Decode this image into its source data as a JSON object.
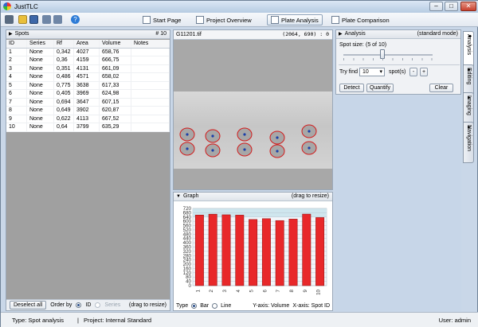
{
  "app": {
    "title": "JustTLC"
  },
  "window_buttons": {
    "minimize": "–",
    "maximize": "□",
    "close": "✕"
  },
  "toolbar": {
    "icons": [
      "menu-icon",
      "open-folder-icon",
      "save-icon",
      "undo-icon",
      "redo-icon",
      "help-icon"
    ],
    "nav": [
      {
        "label": "Start Page",
        "icon": "home-icon"
      },
      {
        "label": "Project Overview",
        "icon": "overview-icon"
      },
      {
        "label": "Plate Analysis",
        "icon": "plate-icon",
        "active": true
      },
      {
        "label": "Plate Comparison",
        "icon": "compare-icon"
      }
    ]
  },
  "spots": {
    "title": "Spots",
    "count": "# 10",
    "columns": [
      "ID",
      "Series",
      "Rf",
      "Area",
      "Volume",
      "Notes"
    ],
    "rows": [
      [
        "1",
        "None",
        "0,342",
        "4027",
        "658,76",
        ""
      ],
      [
        "2",
        "None",
        "0,36",
        "4159",
        "666,75",
        ""
      ],
      [
        "3",
        "None",
        "0,351",
        "4131",
        "661,09",
        ""
      ],
      [
        "4",
        "None",
        "0,486",
        "4571",
        "658,02",
        ""
      ],
      [
        "5",
        "None",
        "0,775",
        "3638",
        "617,33",
        ""
      ],
      [
        "6",
        "None",
        "0,405",
        "3969",
        "624,98",
        ""
      ],
      [
        "7",
        "None",
        "0,694",
        "3647",
        "607,15",
        ""
      ],
      [
        "8",
        "None",
        "0,649",
        "3902",
        "620,87",
        ""
      ],
      [
        "9",
        "None",
        "0,622",
        "4113",
        "667,52",
        ""
      ],
      [
        "10",
        "None",
        "0,64",
        "3799",
        "635,29",
        ""
      ]
    ],
    "footer": {
      "deselect": "Deselect all",
      "order_by": "Order by",
      "opt_id": "ID",
      "opt_series": "Series",
      "drag": "(drag to resize)"
    }
  },
  "image": {
    "filename": "G11201.tif",
    "coords": "(2064, 690) :",
    "value": "0",
    "lanes": 5
  },
  "graph": {
    "title": "Graph",
    "drag": "(drag to resize)",
    "footer": {
      "type_label": "Type",
      "opt_bar": "Bar",
      "opt_line": "Line",
      "y_axis": "Y-axis: Volume",
      "x_axis": "X-axis: Spot ID"
    }
  },
  "chart_data": {
    "type": "bar",
    "categories": [
      "1",
      "2",
      "3",
      "4",
      "5",
      "6",
      "7",
      "8",
      "9",
      "10"
    ],
    "values": [
      658.76,
      666.75,
      661.09,
      658.02,
      617.33,
      624.98,
      607.15,
      620.87,
      667.52,
      635.29
    ],
    "ylim": [
      0,
      720
    ],
    "yticks": [
      "0",
      "40",
      "80",
      "120",
      "160",
      "200",
      "240",
      "280",
      "320",
      "360",
      "400",
      "440",
      "480",
      "520",
      "560",
      "600",
      "640",
      "680",
      "720"
    ],
    "grid": true,
    "bar_color": "#e8282a"
  },
  "analysis": {
    "title": "Analysis",
    "mode": "(standard mode)",
    "spot_size_label": "Spot size:",
    "spot_size_value": "(5 of 10)",
    "slider_fraction": 0.44,
    "try_find_label": "Try find",
    "try_find_value": "10",
    "spots_label": "spot(s)",
    "minus": "-",
    "plus": "+",
    "detect": "Detect",
    "quantify": "Quantify",
    "clear": "Clear"
  },
  "side_tabs": [
    "Analysis",
    "Editing",
    "Imaging",
    "Navigation"
  ],
  "status": {
    "type": "Type:  Spot analysis",
    "separator": "|",
    "project": "Project:  Internal Standard",
    "user": "User:  admin"
  },
  "colors": {
    "accent": "#1f3d5a",
    "bar": "#e8282a",
    "spot_outline": "#d31a1a",
    "spot_center": "#1a3fa8"
  }
}
